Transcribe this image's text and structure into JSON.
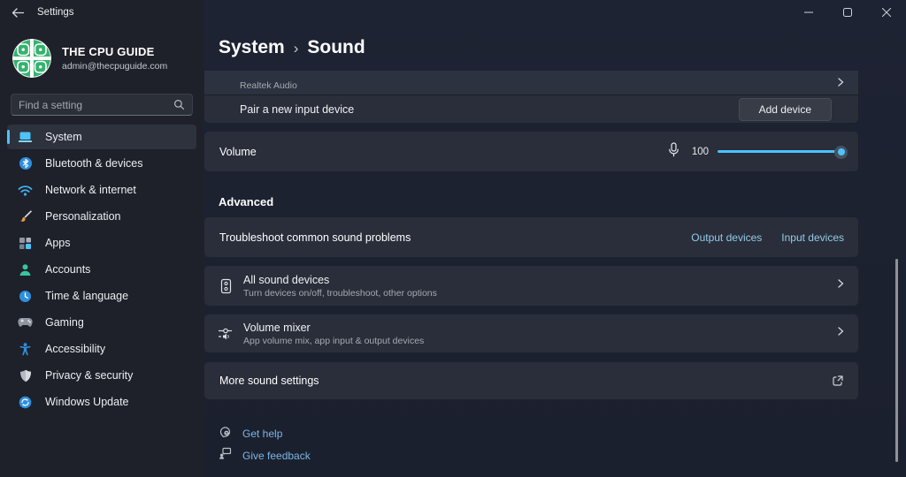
{
  "window": {
    "title": "Settings"
  },
  "sidebar": {
    "profile": {
      "name": "THE CPU GUIDE",
      "email": "admin@thecpuguide.com"
    },
    "search": {
      "placeholder": "Find a setting"
    },
    "items": [
      {
        "label": "System",
        "selected": true
      },
      {
        "label": "Bluetooth & devices"
      },
      {
        "label": "Network & internet"
      },
      {
        "label": "Personalization"
      },
      {
        "label": "Apps"
      },
      {
        "label": "Accounts"
      },
      {
        "label": "Time & language"
      },
      {
        "label": "Gaming"
      },
      {
        "label": "Accessibility"
      },
      {
        "label": "Privacy & security"
      },
      {
        "label": "Windows Update"
      }
    ]
  },
  "main": {
    "breadcrumb": {
      "parent": "System",
      "sep": "›",
      "current": "Sound"
    },
    "device_list": {
      "partial_subtitle": "Realtek Audio",
      "pair_label": "Pair a new input device",
      "add_button": "Add device"
    },
    "volume": {
      "label": "Volume",
      "value": "100"
    },
    "advanced": {
      "title": "Advanced",
      "troubleshoot": {
        "label": "Troubleshoot common sound problems",
        "links": [
          "Output devices",
          "Input devices"
        ]
      },
      "all_devices": {
        "title": "All sound devices",
        "subtitle": "Turn devices on/off, troubleshoot, other options"
      },
      "mixer": {
        "title": "Volume mixer",
        "subtitle": "App volume mix, app input & output devices"
      },
      "more": {
        "label": "More sound settings"
      }
    },
    "footer": [
      {
        "label": "Get help"
      },
      {
        "label": "Give feedback"
      }
    ]
  },
  "colors": {
    "accent": "#4cc2ff",
    "link": "#93cbe9",
    "card_bg": "#292e3a",
    "main_bg": "#1d2230",
    "sidebar_bg": "#1e212a"
  }
}
